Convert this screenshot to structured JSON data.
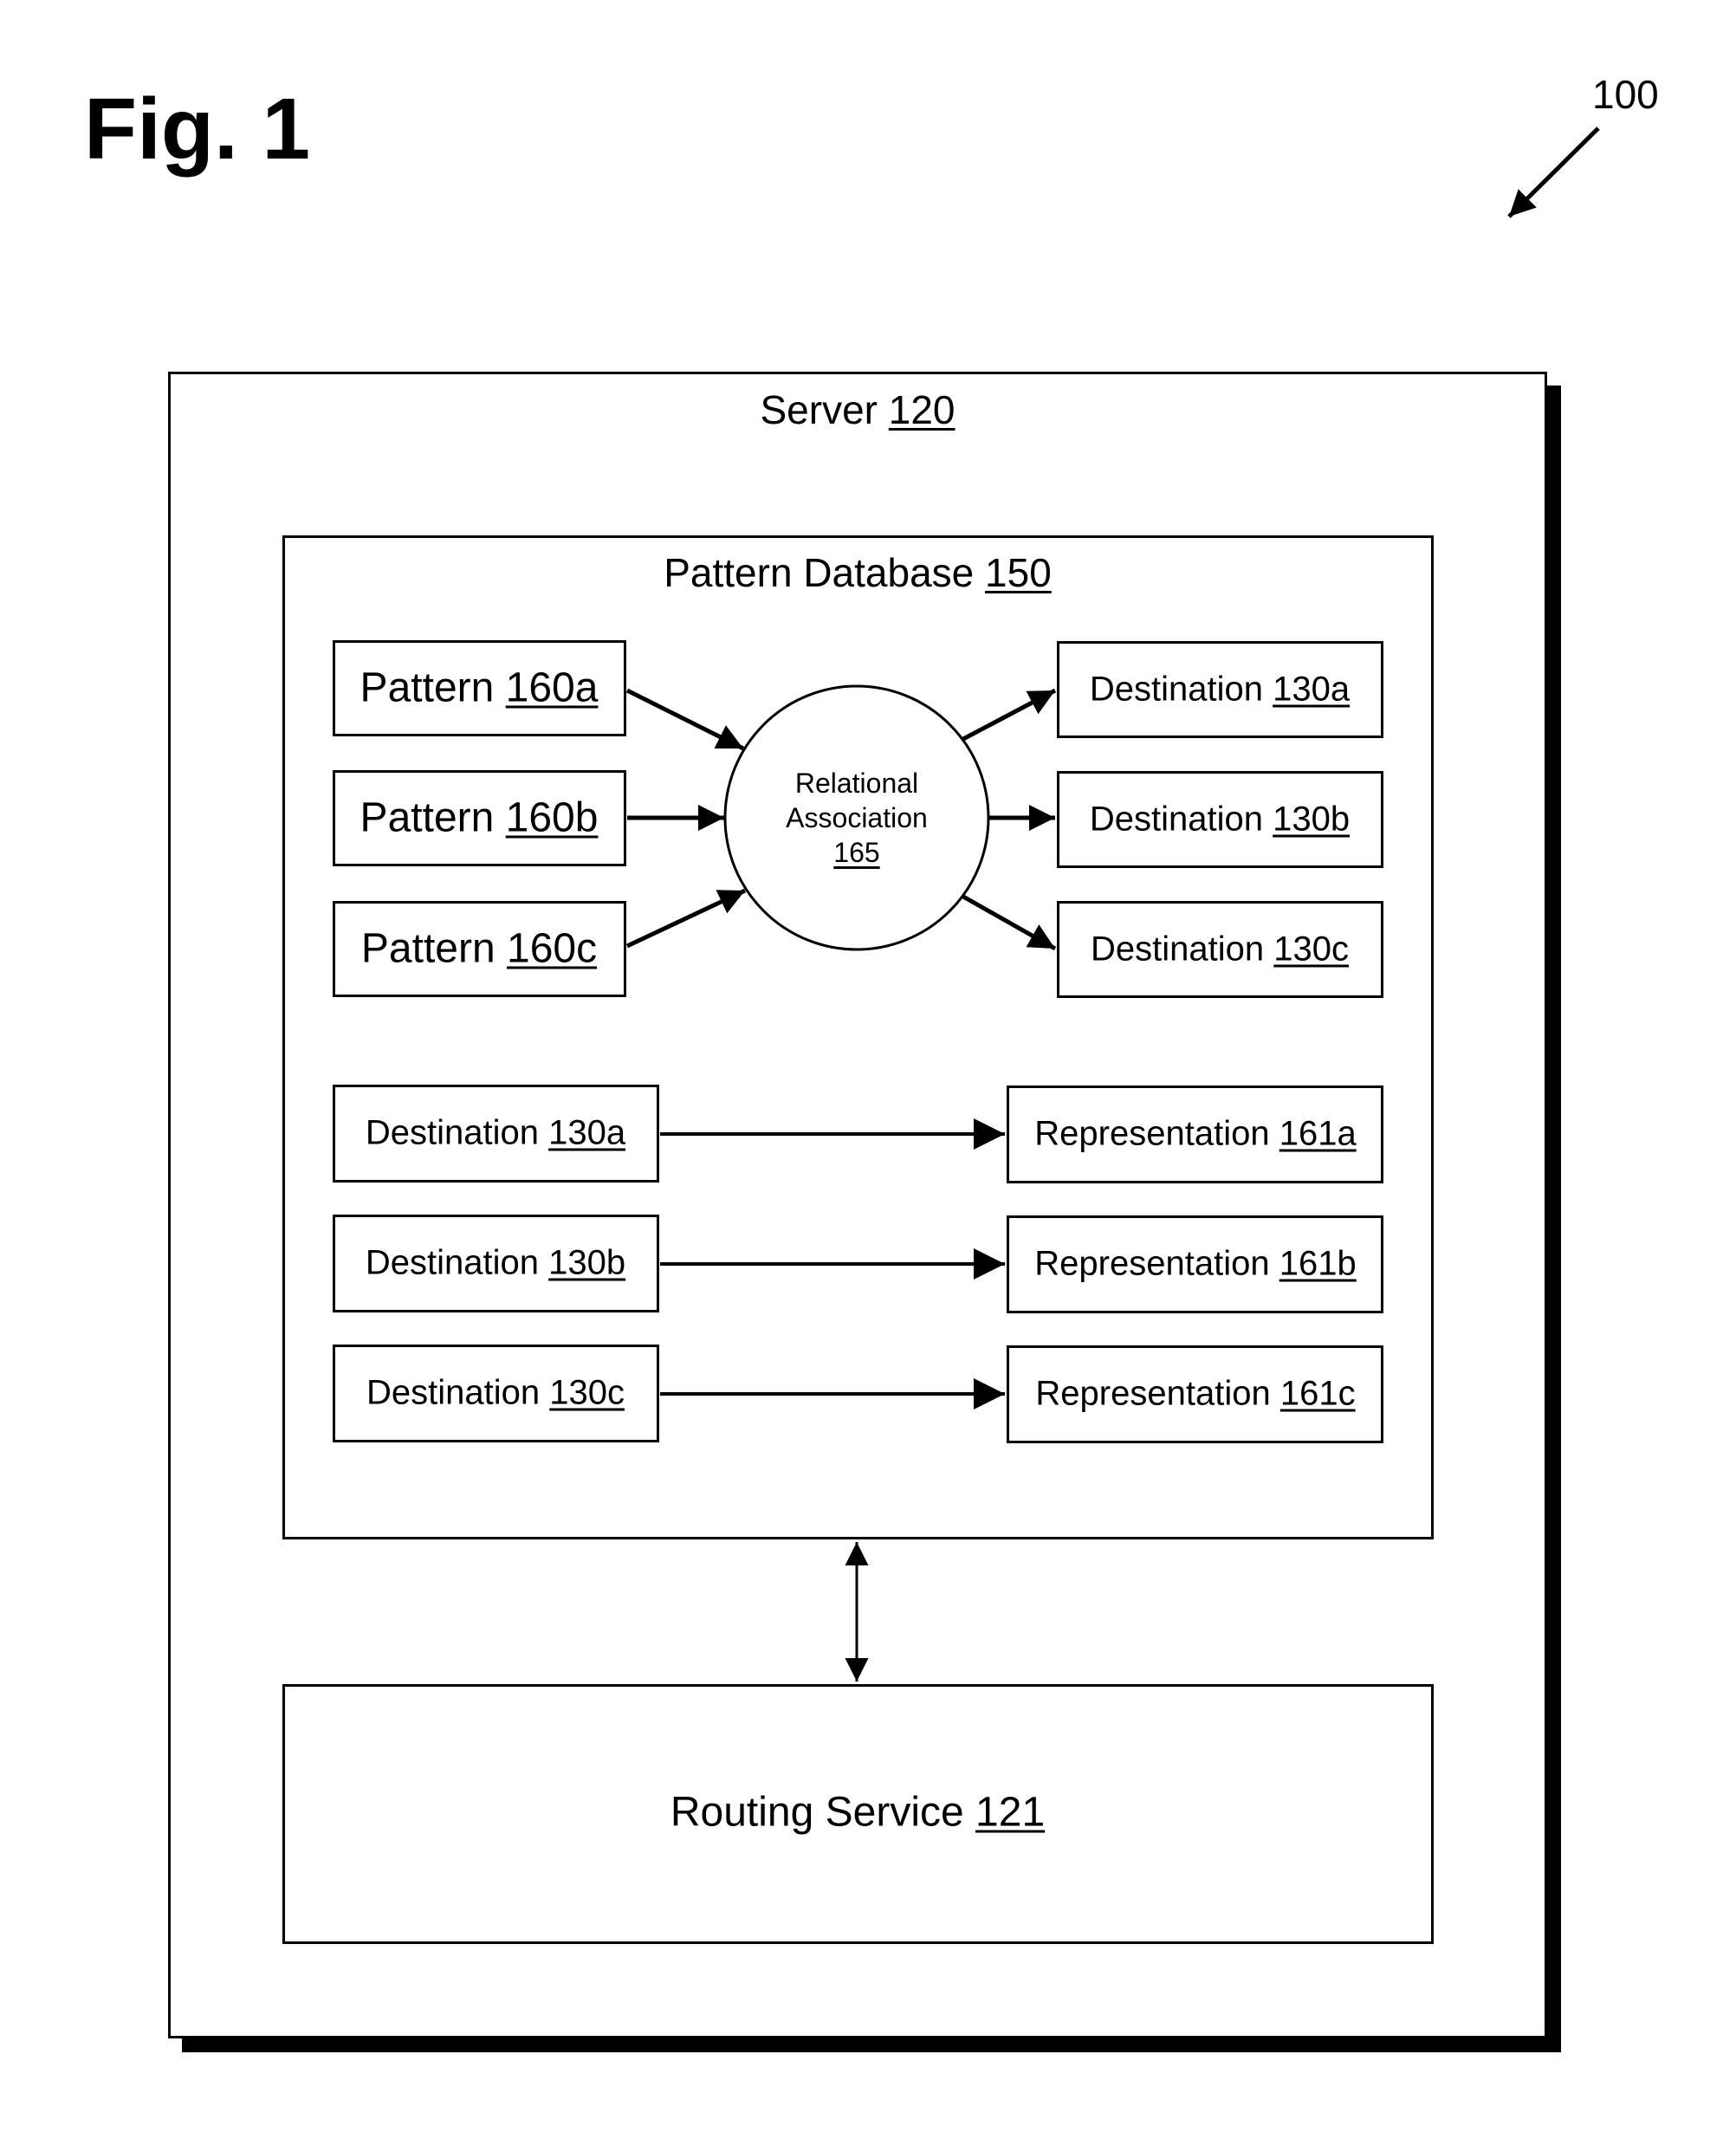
{
  "figure": {
    "title": "Fig. 1",
    "reference": "100"
  },
  "server": {
    "name": "Server",
    "ref": "120"
  },
  "pattern_database": {
    "name": "Pattern Database",
    "ref": "150",
    "patterns": [
      {
        "name": "Pattern",
        "ref": "160a"
      },
      {
        "name": "Pattern",
        "ref": "160b"
      },
      {
        "name": "Pattern",
        "ref": "160c"
      }
    ],
    "relational_association": {
      "line1": "Relational",
      "line2": "Association",
      "ref": "165"
    },
    "destinations": [
      {
        "name": "Destination",
        "ref": "130a"
      },
      {
        "name": "Destination",
        "ref": "130b"
      },
      {
        "name": "Destination",
        "ref": "130c"
      }
    ],
    "mappings": [
      {
        "destination": {
          "name": "Destination",
          "ref": "130a"
        },
        "representation": {
          "name": "Representation",
          "ref": "161a"
        }
      },
      {
        "destination": {
          "name": "Destination",
          "ref": "130b"
        },
        "representation": {
          "name": "Representation",
          "ref": "161b"
        }
      },
      {
        "destination": {
          "name": "Destination",
          "ref": "130c"
        },
        "representation": {
          "name": "Representation",
          "ref": "161c"
        }
      }
    ]
  },
  "routing_service": {
    "name": "Routing Service",
    "ref": "121"
  }
}
